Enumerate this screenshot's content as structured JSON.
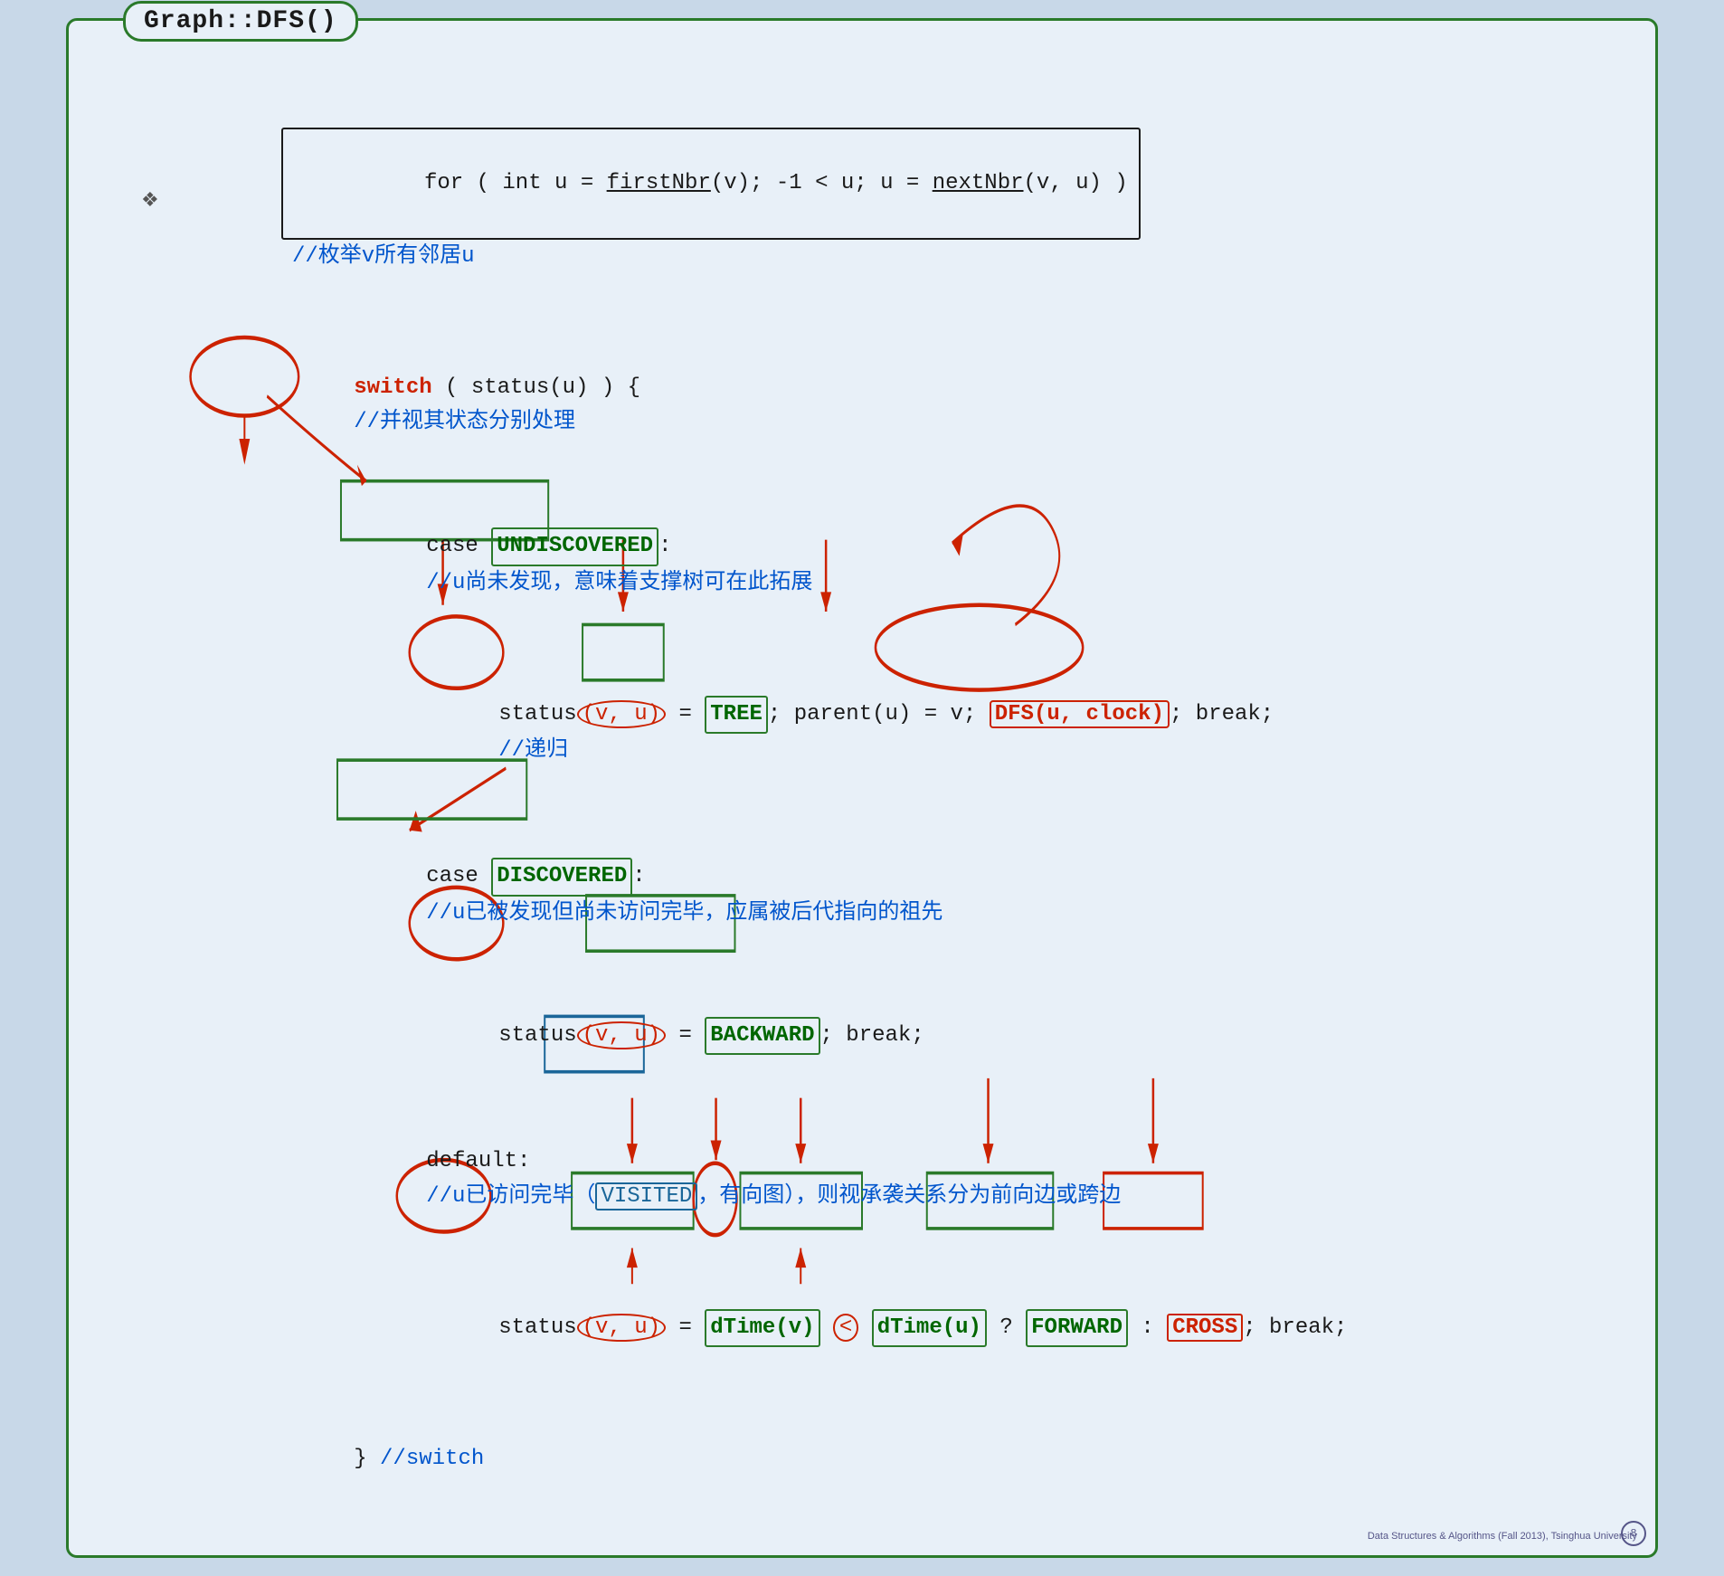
{
  "title": "Graph::DFS()",
  "slide": {
    "lines": [
      {
        "id": "for-loop",
        "indent": 0,
        "has_bullet": true,
        "code": "for ( int u = firstNbr(v); -1 < u; u = nextNbr(v, u) )",
        "comment": "//枚举v所有邻居u"
      },
      {
        "id": "switch",
        "indent": 1,
        "code": "switch ( status(u) ) { //并视其状态分别处理"
      },
      {
        "id": "case-undiscovered",
        "indent": 2,
        "code": "case UNDISCOVERED: //u尚未发现，意味着支撑树可在此拓展"
      },
      {
        "id": "status-tree",
        "indent": 3,
        "code": "status(v, u) = TREE; parent(u) = v; DFS(u, clock); break; //递归"
      },
      {
        "id": "case-discovered",
        "indent": 2,
        "code": "case DISCOVERED: //u已被发现但尚未访问完毕，应属被后代指向的祖先"
      },
      {
        "id": "status-backward",
        "indent": 3,
        "code": "status(v, u) = BACKWARD; break;"
      },
      {
        "id": "default",
        "indent": 2,
        "code": "default: //u已访问完毕（VISITED，有向图），则视承袭关系分为前向边或跨边"
      },
      {
        "id": "status-forward-cross",
        "indent": 3,
        "code": "status(v, u) = dTime(v) < dTime(u) ? FORWARD : CROSS; break;"
      },
      {
        "id": "close-switch",
        "indent": 1,
        "code": "} //switch"
      }
    ]
  },
  "watermark": "Data Structures & Algorithms (Fall 2013), Tsinghua University",
  "page_number": "8"
}
